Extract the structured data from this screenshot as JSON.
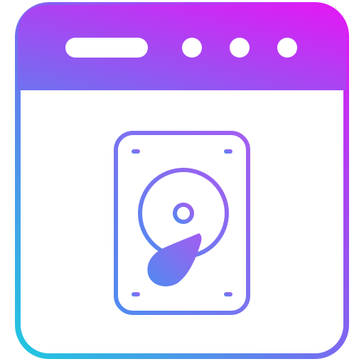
{
  "icon": {
    "name": "browser-window-hard-drive-icon",
    "gradient": {
      "start": "#1fc8e0",
      "mid": "#6f72f0",
      "end": "#e417f5"
    },
    "window": {
      "header_dots": 3,
      "address_bar": "pill"
    },
    "device": {
      "name": "hard-drive",
      "parts": [
        "screw-holes",
        "platter",
        "spindle",
        "read-arm"
      ]
    }
  }
}
